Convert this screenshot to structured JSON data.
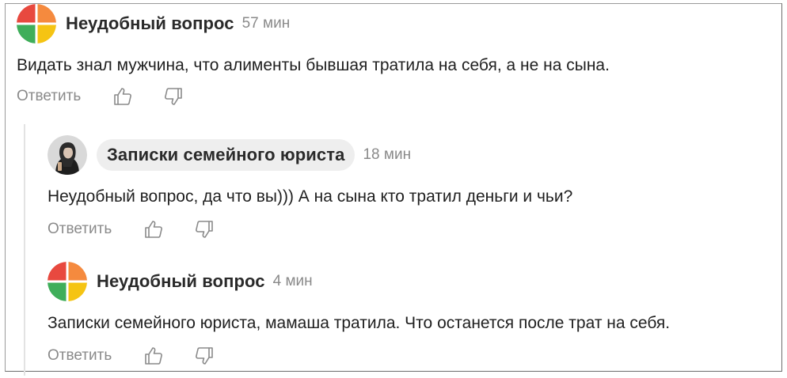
{
  "comments": [
    {
      "author": "Неудобный вопрос",
      "time": "57 мин",
      "text": "Видать знал мужчина, что алименты бывшая тратила на себя, а не на сына.",
      "reply_label": "Ответить",
      "avatar_icon": "colorful-quadrant-avatar"
    },
    {
      "author": "Записки семейного юриста",
      "time": "18 мин",
      "text": "Неудобный вопрос, да что вы))) А на сына кто тратил деньги и чьи?",
      "reply_label": "Ответить",
      "avatar_icon": "photo-avatar"
    },
    {
      "author": "Неудобный вопрос",
      "time": "4 мин",
      "text": "Записки семейного юриста, мамаша тратила. Что останется после трат на себя.",
      "reply_label": "Ответить",
      "avatar_icon": "colorful-quadrant-avatar"
    }
  ],
  "colors": {
    "avatar_red": "#e8493f",
    "avatar_orange": "#f58a3e",
    "avatar_yellow": "#f5c413",
    "avatar_green": "#3fae5a",
    "muted_text": "#8a8a8a",
    "pill_background": "#eeeeee"
  }
}
